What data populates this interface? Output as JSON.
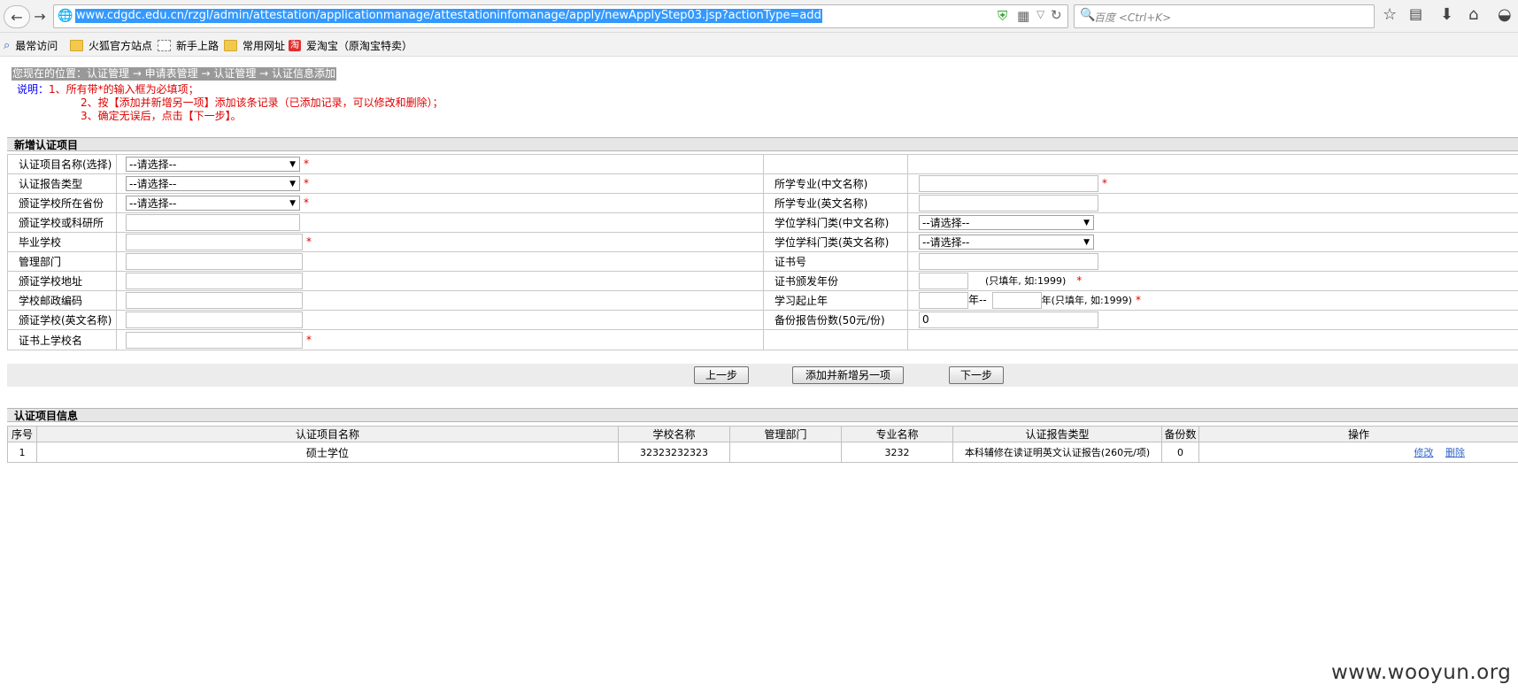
{
  "browser": {
    "url": "www.cdgdc.edu.cn/rzgl/admin/attestation/applicationmanage/attestationinfomanage/apply/newApplyStep03.jsp?actionType=add",
    "search_placeholder": "百度 <Ctrl+K>",
    "bookmarks": [
      "最常访问",
      "火狐官方站点",
      "新手上路",
      "常用网址",
      "爱淘宝（原淘宝特卖）"
    ],
    "taobao_glyph": "淘"
  },
  "page": {
    "breadcrumb": "您现在的位置：认证管理 → 申请表管理 → 认证管理 → 认证信息添加",
    "notes_label": "说明：",
    "notes": [
      "1、所有带*的输入框为必填项；",
      "2、按【添加并新增另一项】添加该条记录（已添加记录，可以修改和删除）；",
      "3、确定无误后，点击【下一步】。"
    ]
  },
  "form": {
    "section_title": "新增认证项目",
    "required_mark": "*",
    "select_placeholder": "--请选择--",
    "left_labels": [
      "认证项目名称(选择)",
      "认证报告类型",
      "颁证学校所在省份",
      "颁证学校或科研所",
      "毕业学校",
      "管理部门",
      "颁证学校地址",
      "学校邮政编码",
      "颁证学校(英文名称)",
      "证书上学校名"
    ],
    "right_labels": [
      "所学专业(中文名称)",
      "所学专业(英文名称)",
      "学位学科门类(中文名称)",
      "学位学科门类(英文名称)",
      "证书号",
      "证书颁发年份",
      "学习起止年",
      "备份报告份数(50元/份)"
    ],
    "year_hint": "(只填年, 如:1999)",
    "study_year_sep": "年--",
    "study_year_hint": "年(只填年, 如:1999)",
    "copies_value": "0",
    "buttons": {
      "prev": "上一步",
      "add_another": "添加并新增另一项",
      "next": "下一步"
    }
  },
  "records": {
    "section_title": "认证项目信息",
    "columns": [
      "序号",
      "认证项目名称",
      "学校名称",
      "管理部门",
      "专业名称",
      "认证报告类型",
      "备份数",
      "操作"
    ],
    "rows": [
      {
        "index": "1",
        "item_name": "硕士学位",
        "school": "32323232323",
        "dept": "",
        "major": "3232",
        "report_type": "本科辅修在读证明英文认证报告(260元/项)",
        "copies": "0",
        "edit": "修改",
        "delete": "删除"
      }
    ]
  },
  "watermark": "www.wooyun.org"
}
